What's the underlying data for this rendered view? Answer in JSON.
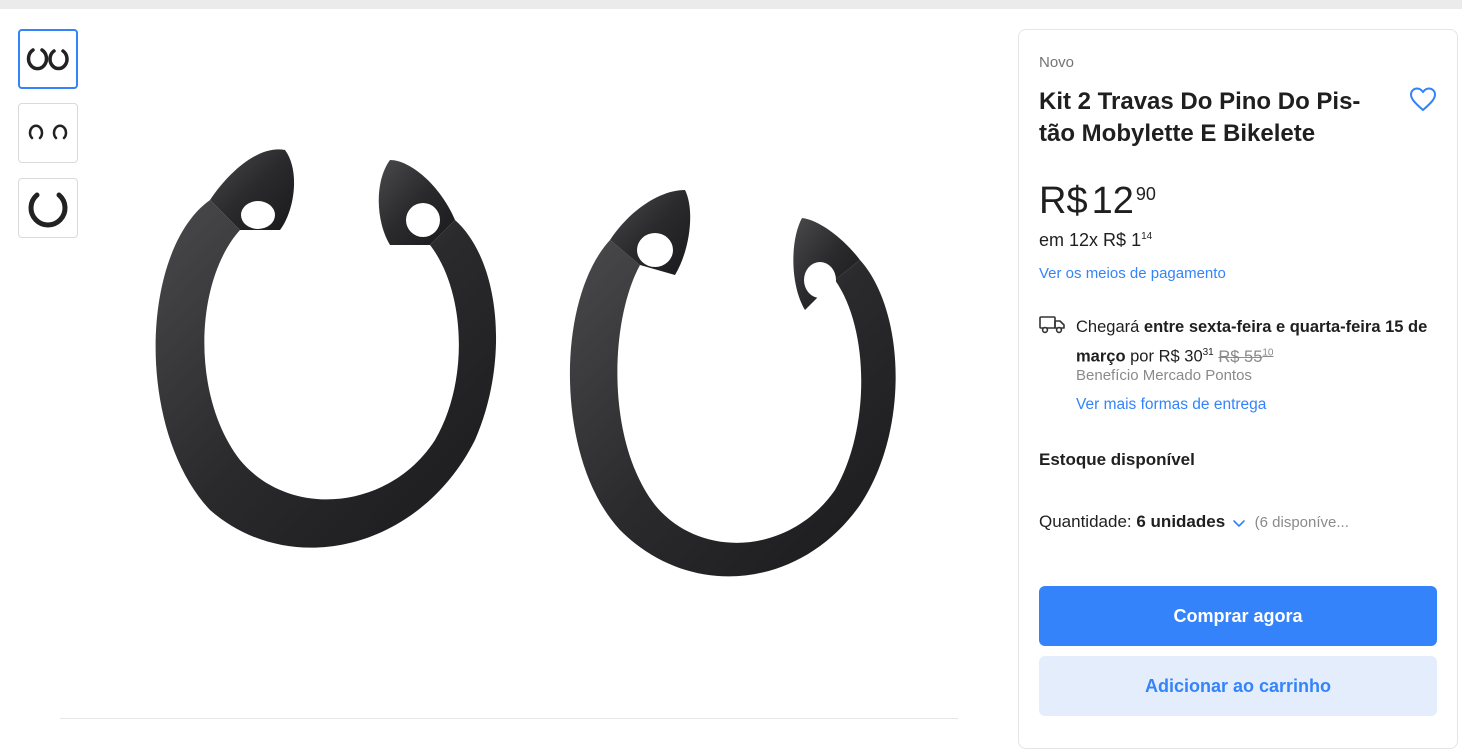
{
  "colors": {
    "accent": "#3483fa",
    "accent_light": "#e3edfb",
    "text": "#1f1f1f",
    "muted": "#8a8a8a"
  },
  "gallery": {
    "thumbnails": [
      {
        "icon": "pair-rings-thumbnail",
        "selected": true
      },
      {
        "icon": "small-rings-thumbnail",
        "selected": false
      },
      {
        "icon": "single-ring-thumbnail",
        "selected": false
      }
    ],
    "main_image_icon": "circlip-rings-photo"
  },
  "product": {
    "condition": "Novo",
    "title": "Kit 2 Travas Do Pino Do Pis-tão Mobylette E Bikelete",
    "favorite_icon": "heart-icon"
  },
  "price": {
    "currency": "R$",
    "integer": "12",
    "cents": "90",
    "installments_prefix": "em 12x",
    "installment_currency": "R$",
    "installment_integer": "1",
    "installment_cents": "14",
    "payment_link": "Ver os meios de pagamento"
  },
  "shipping": {
    "icon": "truck-icon",
    "prefix": "Chegará",
    "dates": "entre sexta-feira e quarta-feira 15 de março",
    "by": "por",
    "currency": "R$",
    "price_integer": "30",
    "price_cents": "31",
    "old_price_integer": "R$ 55",
    "old_price_cents": "10",
    "benefit": "Benefício Mercado Pontos",
    "more_link": "Ver mais formas de entrega"
  },
  "stock": {
    "label": "Estoque disponível"
  },
  "quantity": {
    "label": "Quantidade:",
    "value": "6 unidades",
    "available": "(6 disponíve..."
  },
  "buttons": {
    "buy_now": "Comprar agora",
    "add_to_cart": "Adicionar ao carrinho"
  }
}
